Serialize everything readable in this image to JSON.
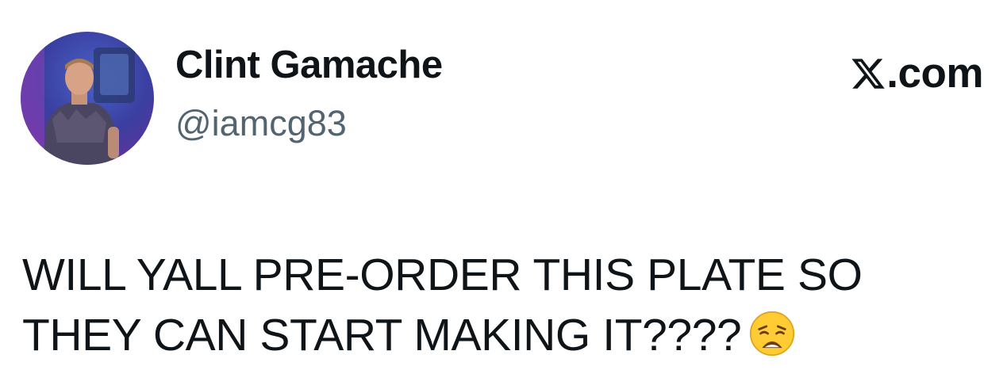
{
  "author": {
    "display_name": "Clint Gamache",
    "handle": "@iamcg83",
    "avatar_icon": "profile-photo-avatar"
  },
  "brand": {
    "icon": "x-logo-icon",
    "label": ".com"
  },
  "tweet": {
    "line1": "WILL YALL PRE-ORDER THIS PLATE SO",
    "line2": "THEY CAN START MAKING IT????",
    "emoji": "weary-face-emoji"
  },
  "colors": {
    "text_primary": "#0f1419",
    "text_secondary": "#536471",
    "background": "#ffffff"
  }
}
